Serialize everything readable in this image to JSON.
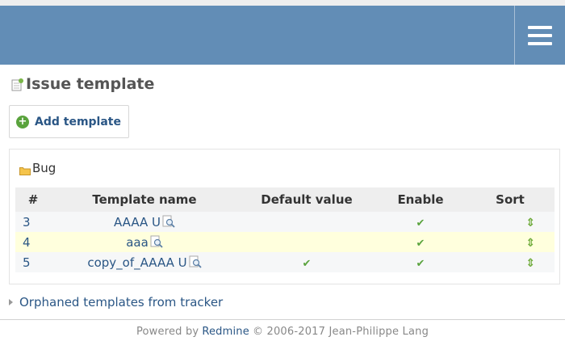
{
  "page": {
    "title": "Issue template",
    "add_button_label": "Add template"
  },
  "tracker_box": {
    "tracker_name": "Bug",
    "columns": [
      "#",
      "Template name",
      "Default value",
      "Enable",
      "Sort"
    ],
    "rows": [
      {
        "id": "3",
        "name": "AAAA U",
        "default": false,
        "enabled": true
      },
      {
        "id": "4",
        "name": "aaa",
        "default": false,
        "enabled": true
      },
      {
        "id": "5",
        "name": "copy_of_AAAA U",
        "default": true,
        "enabled": true
      }
    ]
  },
  "orphaned_link": "Orphaned templates from tracker",
  "footer": {
    "prefix": "Powered by",
    "link": "Redmine",
    "suffix": "© 2006-2017 Jean-Philippe Lang"
  },
  "glyphs": {
    "check": "✔",
    "sort": "⇕",
    "plus": "+"
  },
  "colors": {
    "header": "#628db6",
    "link": "#2a5685",
    "check": "#5aa33d",
    "even_row": "#ffffdd"
  },
  "icons": [
    "menu-icon",
    "template-icon",
    "add-icon",
    "folder-icon",
    "magnifier-icon",
    "check-icon",
    "sort-icon",
    "expand-triangle-icon"
  ]
}
